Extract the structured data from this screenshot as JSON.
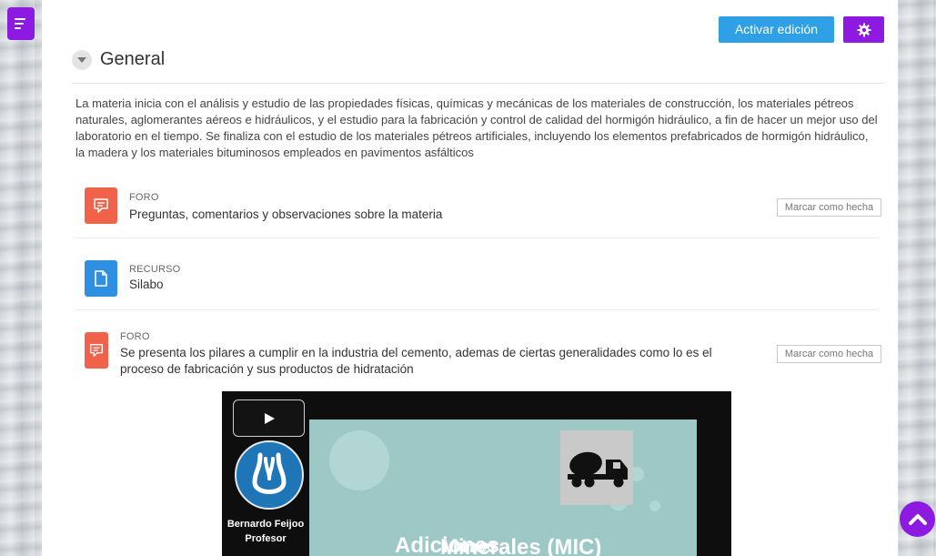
{
  "header": {
    "edit_button_label": "Activar edición",
    "settings_icon": "gear-icon"
  },
  "section": {
    "title": "General",
    "summary": "La materia inicia con el análisis y estudio de las propiedades físicas, químicas y mecánicas de los materiales de construcción, los materiales pétreos naturales, aglomerantes aéreos e hidráulicos, y el estudio para la fabricación y control de calidad del hormigón hidráulico, a fin de hacer un mejor uso del laboratorio en el tiempo. Se finaliza con el estudio de los materiales pétreos artificiales, incluyendo los elementos prefabricados de hormigón hidráulico, la madera y los materiales bituminosos empleados en pavimentos asfálticos"
  },
  "activities": [
    {
      "type": "FORO",
      "name": "Preguntas, comentarios y observaciones sobre la materia",
      "icon": "forum-icon",
      "color": "#f0624a",
      "completion_label": "Marcar como hecha"
    },
    {
      "type": "RECURSO",
      "name": "Silabo",
      "icon": "file-icon",
      "color": "#2f8fe0"
    },
    {
      "type": "FORO",
      "name": "Se presenta los pilares a cumplir en la industria del cemento, ademas de ciertas generalidades como lo es el proceso de fabricación y sus productos de hidratación",
      "icon": "forum-icon",
      "color": "#f0624a",
      "completion_label": "Marcar como hecha"
    }
  ],
  "video": {
    "presenter_name": "Bernardo Feijoo",
    "presenter_role": "Profesor",
    "slide_title_line1": "Adiciones",
    "slide_title_line2": "Minerales (MIC)"
  },
  "colors": {
    "accent_purple": "#8c1ae0",
    "button_blue": "#2fa0e6",
    "forum_orange": "#f0624a",
    "resource_blue": "#2f8fe0"
  }
}
